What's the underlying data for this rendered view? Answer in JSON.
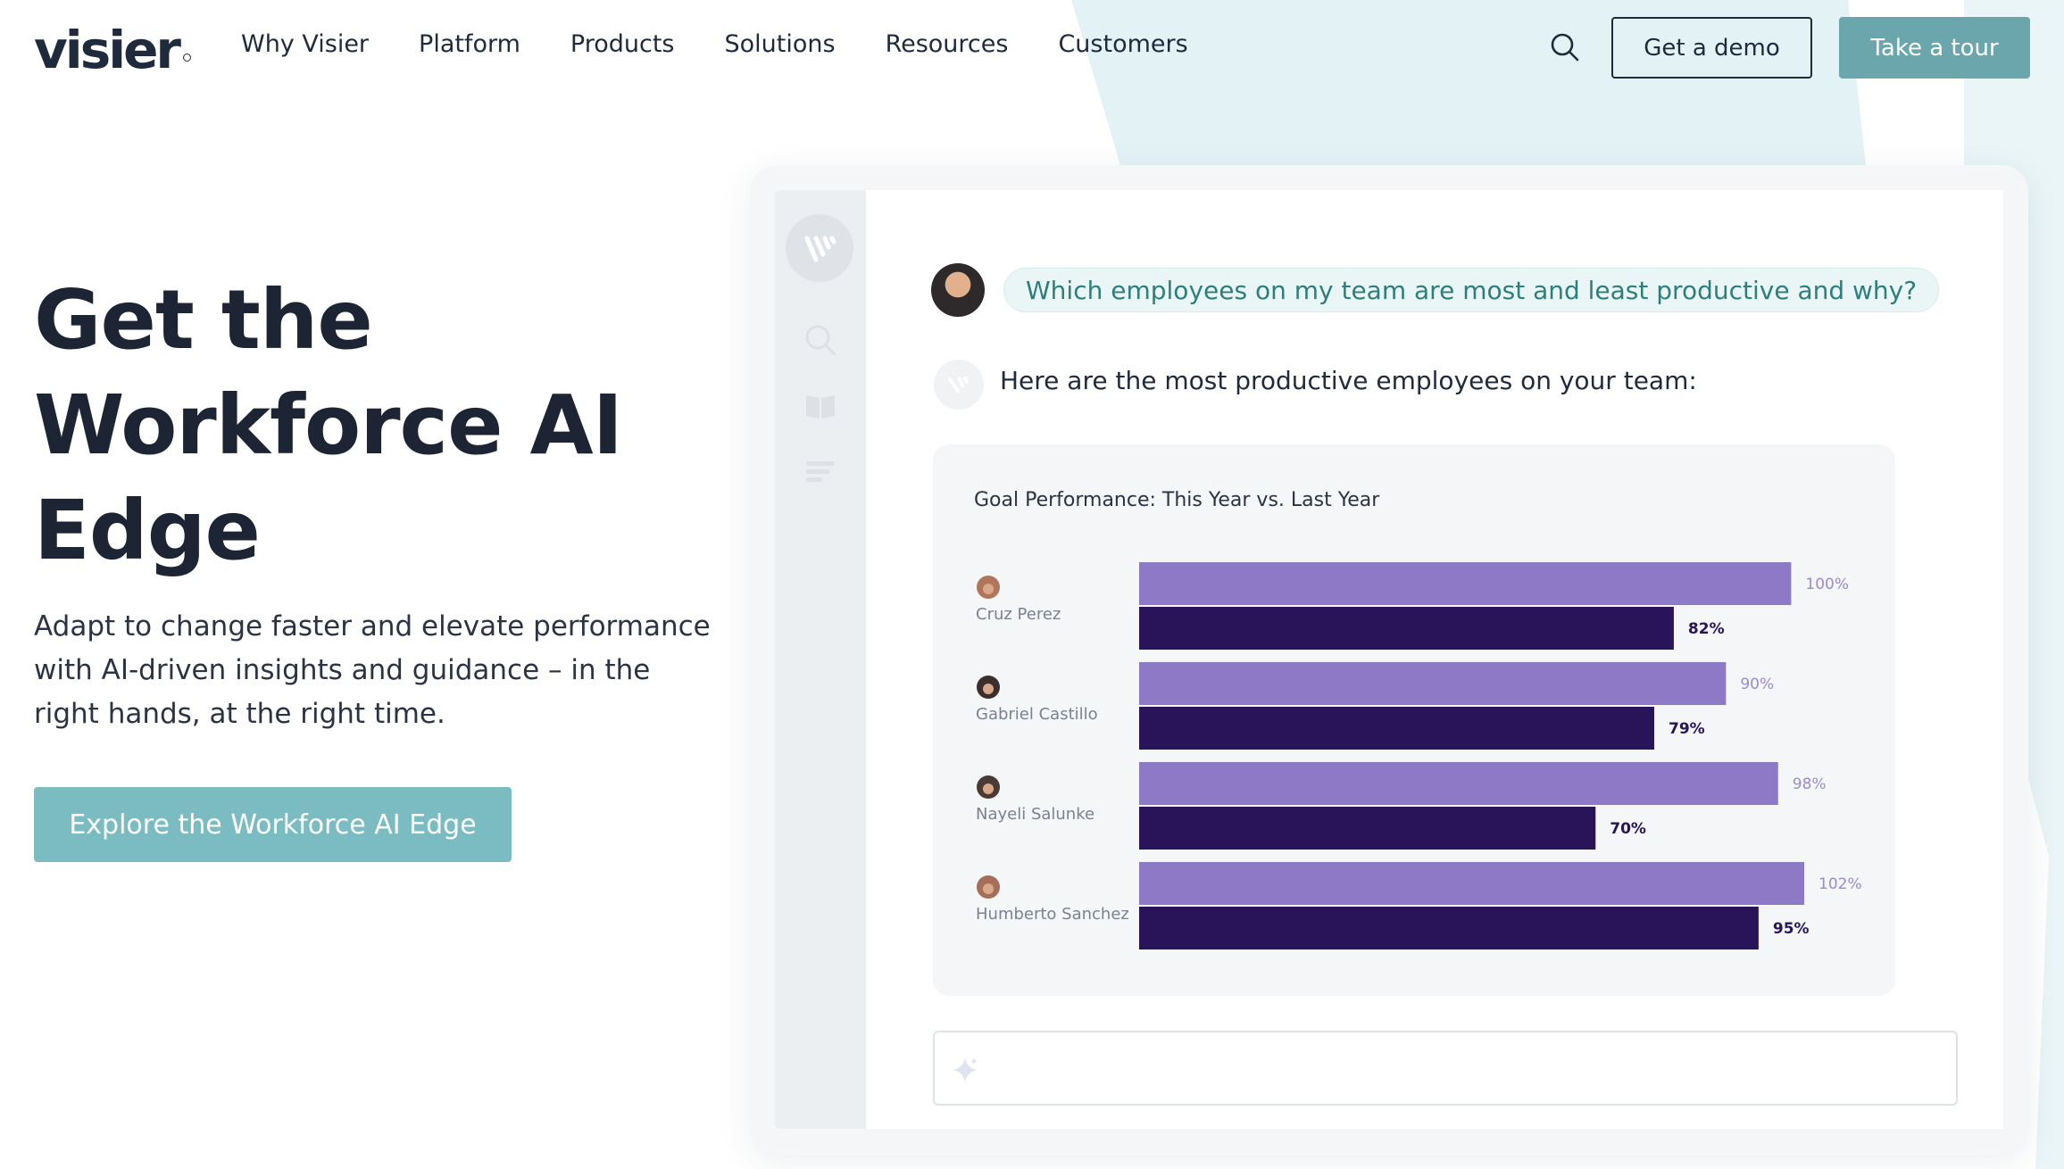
{
  "nav": {
    "logo": "visier",
    "links": [
      "Why Visier",
      "Platform",
      "Products",
      "Solutions",
      "Resources",
      "Customers"
    ],
    "demo_label": "Get a demo",
    "tour_label": "Take a tour"
  },
  "hero": {
    "title_line1": "Get the",
    "title_line2": "Workforce AI",
    "title_line3": "Edge",
    "subtitle_line1": "Adapt to change faster and elevate performance",
    "subtitle_line2": "with AI-driven insights and guidance – in the",
    "subtitle_line3": "right hands, at the right time.",
    "cta_label": "Explore the Workforce AI Edge"
  },
  "app": {
    "question": "Which employees on my team are most and least productive and why?",
    "answer": "Here are the most productive employees on your team:"
  },
  "colors": {
    "accent_teal": "#6aa6ac",
    "cta_teal": "#7bbcc3",
    "this_year": "#8e79c6",
    "last_year": "#2a1459"
  },
  "chart_data": {
    "type": "bar",
    "orientation": "horizontal",
    "title": "Goal Performance: This Year vs. Last Year",
    "categories": [
      "Cruz Perez",
      "Gabriel Castillo",
      "Nayeli Salunke",
      "Humberto Sanchez"
    ],
    "series": [
      {
        "values": [
          100,
          90,
          98,
          102
        ],
        "labels": [
          "100%",
          "90%",
          "98%",
          "102%"
        ]
      },
      {
        "values": [
          82,
          79,
          70,
          95
        ],
        "labels": [
          "82%",
          "79%",
          "70%",
          "95%"
        ]
      }
    ],
    "xlim": [
      0,
      102
    ],
    "grid": false
  }
}
